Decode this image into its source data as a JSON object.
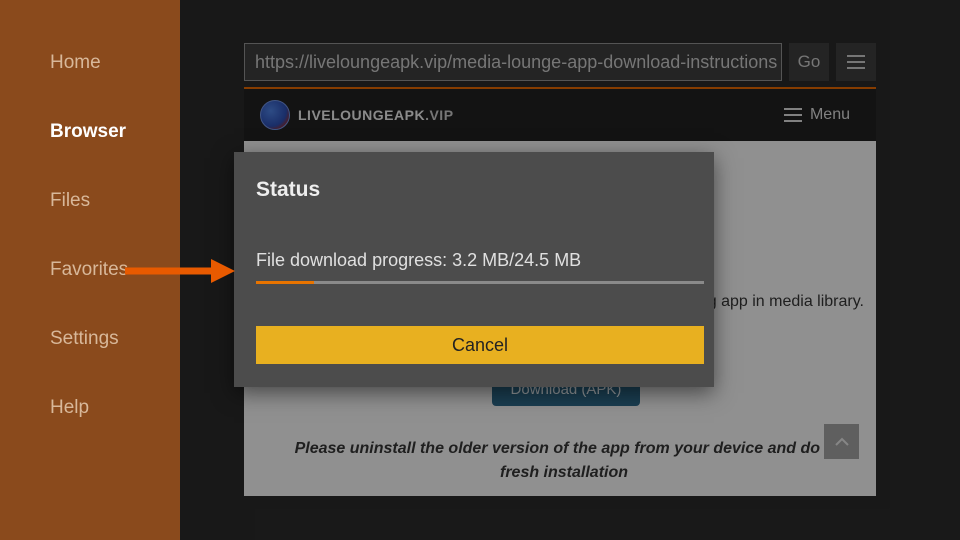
{
  "sidebar": {
    "items": [
      {
        "label": "Home"
      },
      {
        "label": "Browser"
      },
      {
        "label": "Files"
      },
      {
        "label": "Favorites"
      },
      {
        "label": "Settings"
      },
      {
        "label": "Help"
      }
    ],
    "active_index": 1
  },
  "browser": {
    "url": "https://liveloungeapk.vip/media-lounge-app-download-instructions",
    "go_label": "Go"
  },
  "site": {
    "brand_main": "LIVELOUNGEAPK",
    "brand_suffix": ".VIP",
    "menu_label": "Menu",
    "body_text": "reaming app in media library.",
    "download_btn": "Download (APK)",
    "reminder": "Please uninstall the older version of the app from your device and do a fresh installation"
  },
  "dialog": {
    "title": "Status",
    "message_prefix": "File download progress: ",
    "downloaded": "3.2 MB",
    "total": "24.5 MB",
    "percent": 13,
    "cancel_label": "Cancel"
  }
}
